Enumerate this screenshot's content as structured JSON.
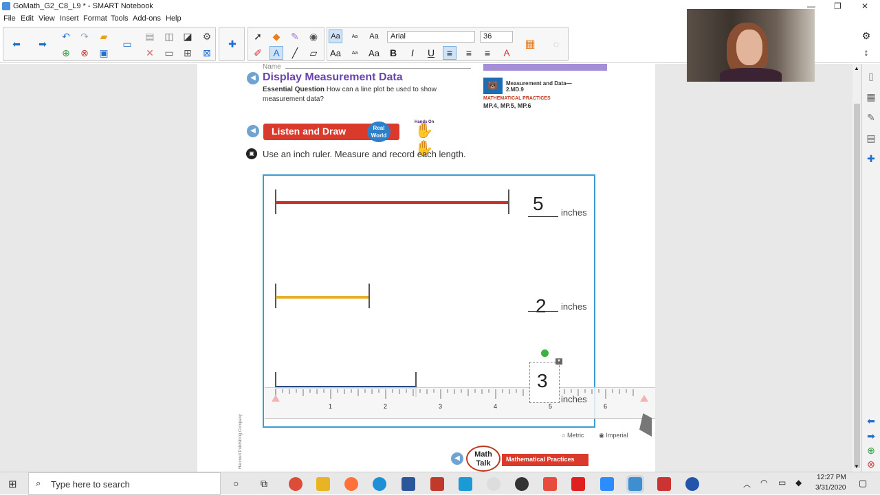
{
  "window": {
    "title": "GoMath_G2_C8_L9 * - SMART Notebook"
  },
  "menu": [
    "File",
    "Edit",
    "View",
    "Insert",
    "Format",
    "Tools",
    "Add-ons",
    "Help"
  ],
  "toolbar": {
    "font_name": "Arial",
    "font_size": "36",
    "aa_labels": [
      "Aa",
      "Aa",
      "Aa",
      "Aa",
      "Aa",
      "Aa"
    ]
  },
  "lesson": {
    "name_label": "Name",
    "title": "Display Measurement Data",
    "eq_label": "Essential Question",
    "eq_text": "How can a line plot be used to show measurement data?",
    "standard_title": "Measurement and Data—",
    "standard_code": "2.MD.9",
    "practices_label": "MATHEMATICAL PRACTICES",
    "practices": "MP.4, MP.5, MP.6",
    "listen_draw": "Listen and Draw",
    "real_world": "Real World",
    "hands_on": "Hands On",
    "instruction": "Use an inch ruler. Measure and record each length.",
    "measurements": [
      {
        "value": "5",
        "unit": "inches",
        "color": "#c8302a"
      },
      {
        "value": "2",
        "unit": "inches",
        "color": "#e6b12a"
      },
      {
        "value": "3",
        "unit": "inches",
        "color": "#2d4a80"
      }
    ],
    "ruler_numbers": [
      "1",
      "2",
      "3",
      "4",
      "5",
      "6"
    ],
    "ruler_options": {
      "metric": "Metric",
      "imperial": "Imperial"
    },
    "math_talk": "Math Talk",
    "math_practices": "Mathematical Practices",
    "publisher": "Harcourt Publishing Company"
  },
  "taskbar": {
    "search_placeholder": "Type here to search",
    "time": "12:27 PM",
    "date": "3/31/2020"
  }
}
